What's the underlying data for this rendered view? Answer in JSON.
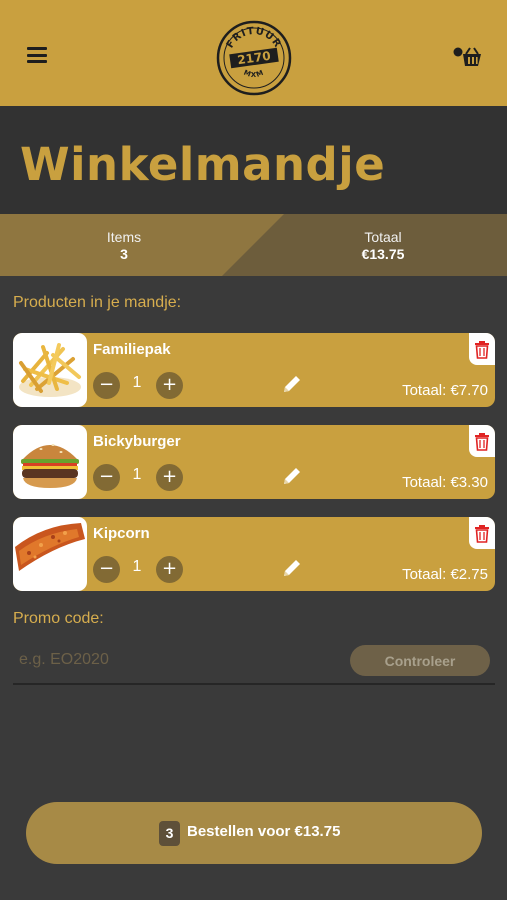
{
  "colors": {
    "accent": "#c9a03f",
    "background": "#3a3a3a",
    "header_band": "#323232",
    "delete_icon": "#e02424"
  },
  "header": {
    "menu_icon": "hamburger-menu-icon",
    "logo": {
      "top_text": "FRITUUR",
      "number": "2170",
      "bottom_text": "MXM"
    },
    "cart_icon": "basket-icon"
  },
  "page": {
    "title": "Winkelmandje"
  },
  "summary": {
    "items_label": "Items",
    "items_value": "3",
    "total_label": "Totaal",
    "total_value": "€13.75"
  },
  "cart": {
    "section_label": "Producten in je mandje:",
    "products": [
      {
        "name": "Familiepak",
        "quantity": "1",
        "total": "Totaal: €7.70",
        "image": "fries-image"
      },
      {
        "name": "Bickyburger",
        "quantity": "1",
        "total": "Totaal: €3.30",
        "image": "burger-image"
      },
      {
        "name": "Kipcorn",
        "quantity": "1",
        "total": "Totaal: €2.75",
        "image": "kipcorn-image"
      }
    ],
    "minus_symbol": "−",
    "plus_symbol": "+"
  },
  "promo": {
    "label": "Promo code:",
    "placeholder": "e.g. EO2020",
    "value": "",
    "button": "Controleer"
  },
  "order": {
    "count": "3",
    "label": "Bestellen voor €13.75"
  }
}
